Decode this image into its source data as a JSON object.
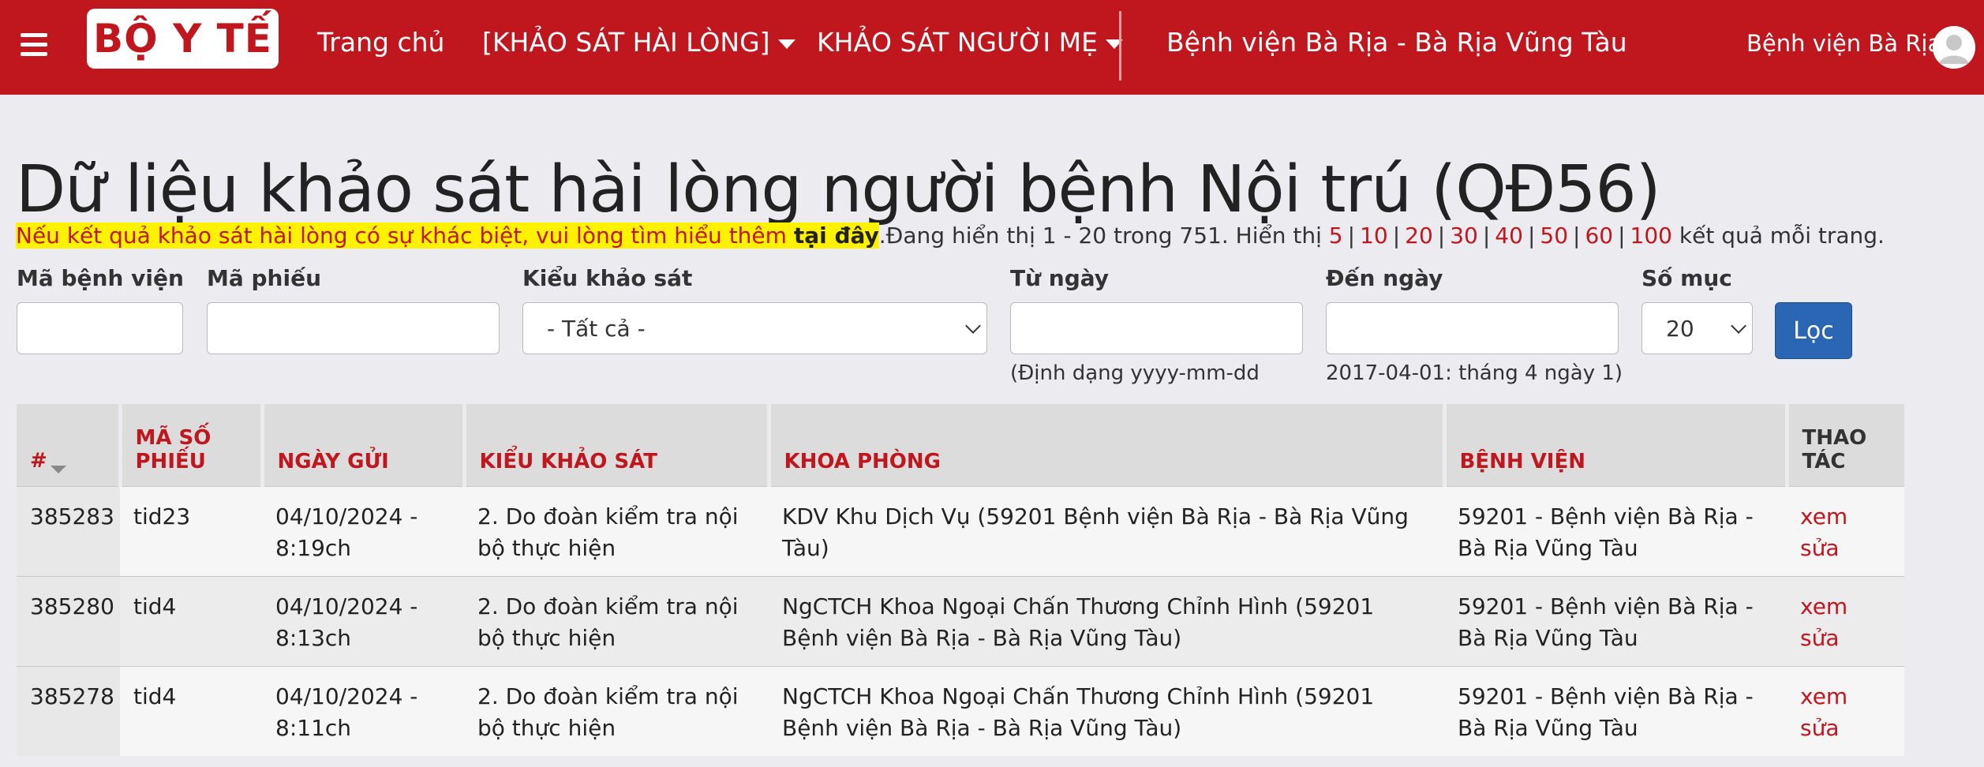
{
  "nav": {
    "logo_text": "BỘ Y TẾ",
    "home": "Trang chủ",
    "survey_satisfaction": "[KHẢO SÁT HÀI LÒNG]",
    "survey_mother": "KHẢO SÁT NGƯỜI MẸ",
    "hospital": "Bệnh viện Bà Rịa - Bà Rịa Vũng Tàu",
    "user": "Bệnh viện Bà Rịa"
  },
  "page": {
    "title": "Dữ liệu khảo sát hài lòng người bệnh Nội trú (QĐ56)"
  },
  "info": {
    "notice": "Nếu kết quả khảo sát hài lòng có sự khác biệt, vui lòng tìm hiểu thêm ",
    "notice_link": "tại đây",
    "showing": ".Đang hiển thị 1 - 20 trong 751. Hiển thị ",
    "page_sizes": [
      "5",
      "10",
      "20",
      "30",
      "40",
      "50",
      "60",
      "100"
    ],
    "per_page_suffix": " kết quả mỗi trang."
  },
  "filters": {
    "hospital_code_label": "Mã bệnh viện",
    "hospital_code_value": "",
    "form_code_label": "Mã phiếu",
    "form_code_value": "",
    "survey_type_label": "Kiểu khảo sát",
    "survey_type_value": "- Tất cả -",
    "from_date_label": "Từ ngày",
    "from_date_value": "",
    "from_date_help": "(Định dạng yyyy-mm-dd",
    "to_date_label": "Đến ngày",
    "to_date_value": "",
    "to_date_help": "2017-04-01: tháng 4 ngày 1)",
    "count_label": "Số mục",
    "count_value": "20",
    "filter_button": "Lọc"
  },
  "table": {
    "headers": {
      "id": "#",
      "code": "MÃ SỐ PHIẾU",
      "date": "NGÀY GỬI",
      "type": "KIỂU KHẢO SÁT",
      "dept": "KHOA PHÒNG",
      "hospital": "BỆNH VIỆN",
      "action": "THAO TÁC"
    },
    "rows": [
      {
        "id": "385283",
        "code": "tid23",
        "date": "04/10/2024 - 8:19ch",
        "type": "2. Do đoàn kiểm tra nội bộ thực hiện",
        "dept": "KDV Khu Dịch Vụ (59201 Bệnh viện Bà Rịa - Bà Rịa Vũng Tàu)",
        "hospital": "59201 - Bệnh viện Bà Rịa - Bà Rịa Vũng Tàu",
        "view": "xem",
        "edit": "sửa"
      },
      {
        "id": "385280",
        "code": "tid4",
        "date": "04/10/2024 - 8:13ch",
        "type": "2. Do đoàn kiểm tra nội bộ thực hiện",
        "dept": "NgCTCH Khoa Ngoại Chấn Thương Chỉnh Hình (59201 Bệnh viện Bà Rịa - Bà Rịa Vũng Tàu)",
        "hospital": "59201 - Bệnh viện Bà Rịa - Bà Rịa Vũng Tàu",
        "view": "xem",
        "edit": "sửa"
      },
      {
        "id": "385278",
        "code": "tid4",
        "date": "04/10/2024 - 8:11ch",
        "type": "2. Do đoàn kiểm tra nội bộ thực hiện",
        "dept": "NgCTCH Khoa Ngoại Chấn Thương Chỉnh Hình (59201 Bệnh viện Bà Rịa - Bà Rịa Vũng Tàu)",
        "hospital": "59201 - Bệnh viện Bà Rịa - Bà Rịa Vũng Tàu",
        "view": "xem",
        "edit": "sửa"
      }
    ]
  },
  "colors": {
    "brand_red": "#c0161e",
    "button_blue": "#2b66b5",
    "highlight_yellow": "#fff200"
  },
  "icons": {
    "menu": "hamburger-icon",
    "dropdown": "caret-down-icon",
    "avatar": "user-avatar-icon",
    "sort": "sort-desc-icon"
  }
}
